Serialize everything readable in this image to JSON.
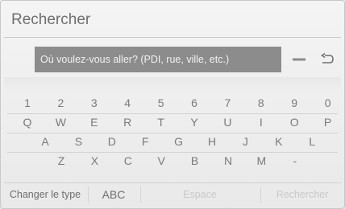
{
  "header": {
    "title": "Rechercher"
  },
  "search": {
    "placeholder": "Où voulez-vous aller? (PDI, rue, ville, etc.)"
  },
  "controls": {
    "delete_icon": "delete-icon",
    "back_icon": "return-icon"
  },
  "keyboard": {
    "rows": [
      [
        "1",
        "2",
        "3",
        "4",
        "5",
        "6",
        "7",
        "8",
        "9",
        "0"
      ],
      [
        "Q",
        "W",
        "E",
        "R",
        "T",
        "Y",
        "U",
        "I",
        "O",
        "P"
      ],
      [
        "A",
        "S",
        "D",
        "F",
        "G",
        "H",
        "J",
        "K",
        "L"
      ],
      [
        "Z",
        "X",
        "C",
        "V",
        "B",
        "N",
        "M",
        "-"
      ]
    ]
  },
  "bottom": {
    "change_type": "Changer le type",
    "mode": "ABC",
    "space": "Espace",
    "search": "Rechercher"
  },
  "colors": {
    "input_bg": "#8c8c8c",
    "key_text": "#7a7a7a",
    "disabled_text": "#c9c9c9"
  }
}
